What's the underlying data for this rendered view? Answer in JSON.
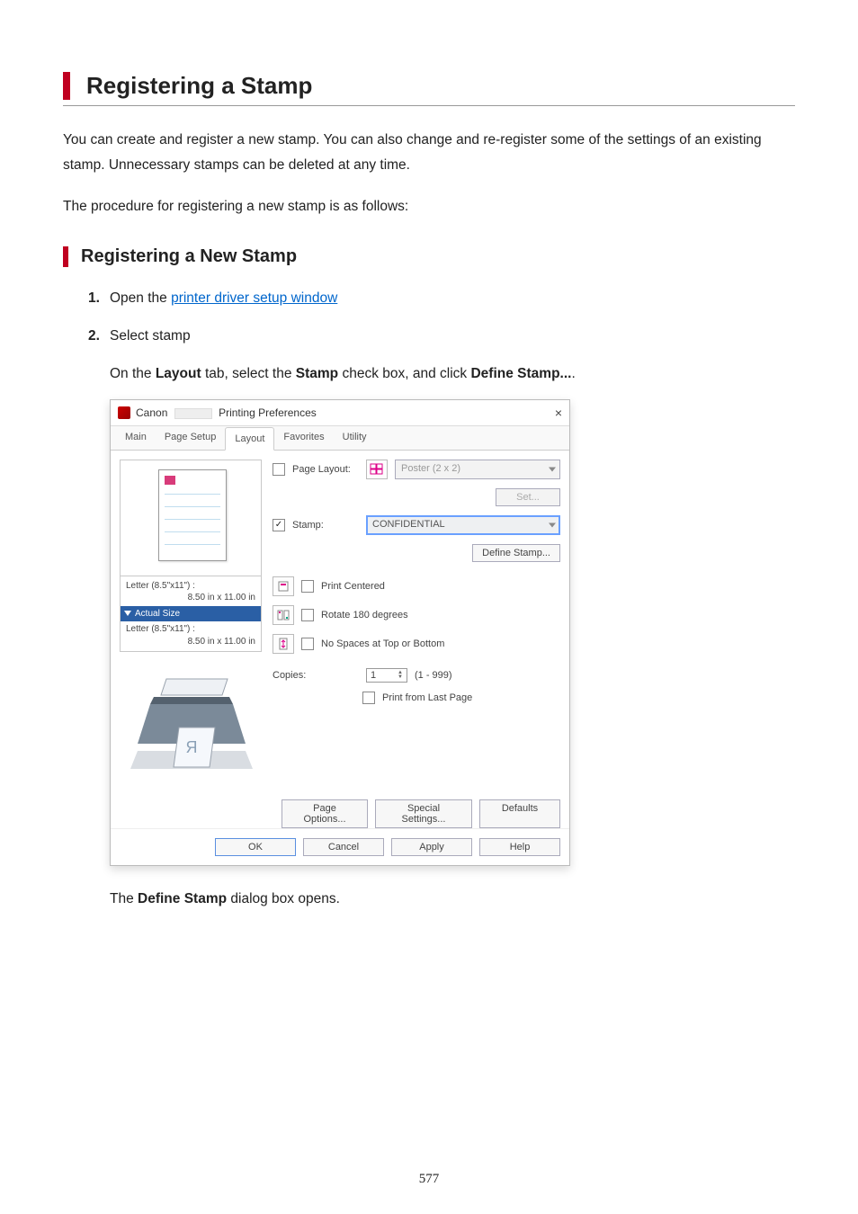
{
  "h1": "Registering a Stamp",
  "intro": "You can create and register a new stamp. You can also change and re-register some of the settings of an existing stamp. Unnecessary stamps can be deleted at any time.",
  "intro2": "The procedure for registering a new stamp is as follows:",
  "h2": "Registering a New Stamp",
  "step1_num": "1.",
  "step1a": "Open the ",
  "step1_link": "printer driver setup window",
  "step2_num": "2.",
  "step2": "Select stamp",
  "step2_sub_a": "On the ",
  "step2_sub_b": "Layout",
  "step2_sub_c": " tab, select the ",
  "step2_sub_d": "Stamp",
  "step2_sub_e": " check box, and click ",
  "step2_sub_f": "Define Stamp...",
  "step2_sub_g": ".",
  "closing_a": "The ",
  "closing_b": "Define Stamp",
  "closing_c": " dialog box opens.",
  "dlg": {
    "title_pre": "Canon",
    "title_post": "Printing Preferences",
    "close": "×",
    "tabs": {
      "main": "Main",
      "pagesetup": "Page Setup",
      "layout": "Layout",
      "favorites": "Favorites",
      "utility": "Utility"
    },
    "page_layout_label": "Page Layout:",
    "page_layout_value": "Poster (2 x 2)",
    "set_btn": "Set...",
    "stamp_label": "Stamp:",
    "stamp_value": "CONFIDENTIAL",
    "define_stamp_btn": "Define Stamp...",
    "print_centered": "Print Centered",
    "rotate_180": "Rotate 180 degrees",
    "no_spaces": "No Spaces at Top or Bottom",
    "copies_label": "Copies:",
    "copies_value": "1",
    "copies_range": "(1 - 999)",
    "print_from_last": "Print from Last Page",
    "page_options_btn": "Page Options...",
    "special_settings_btn": "Special Settings...",
    "defaults_btn": "Defaults",
    "ok": "OK",
    "cancel": "Cancel",
    "apply": "Apply",
    "help": "Help",
    "info_line1a": "Letter (8.5\"x11\") :",
    "info_line1b": "8.50 in x 11.00 in",
    "info_actual": "Actual Size",
    "info_line2a": "Letter (8.5\"x11\") :",
    "info_line2b": "8.50 in x 11.00 in",
    "printer_watermark": "R"
  },
  "page_number": "577"
}
